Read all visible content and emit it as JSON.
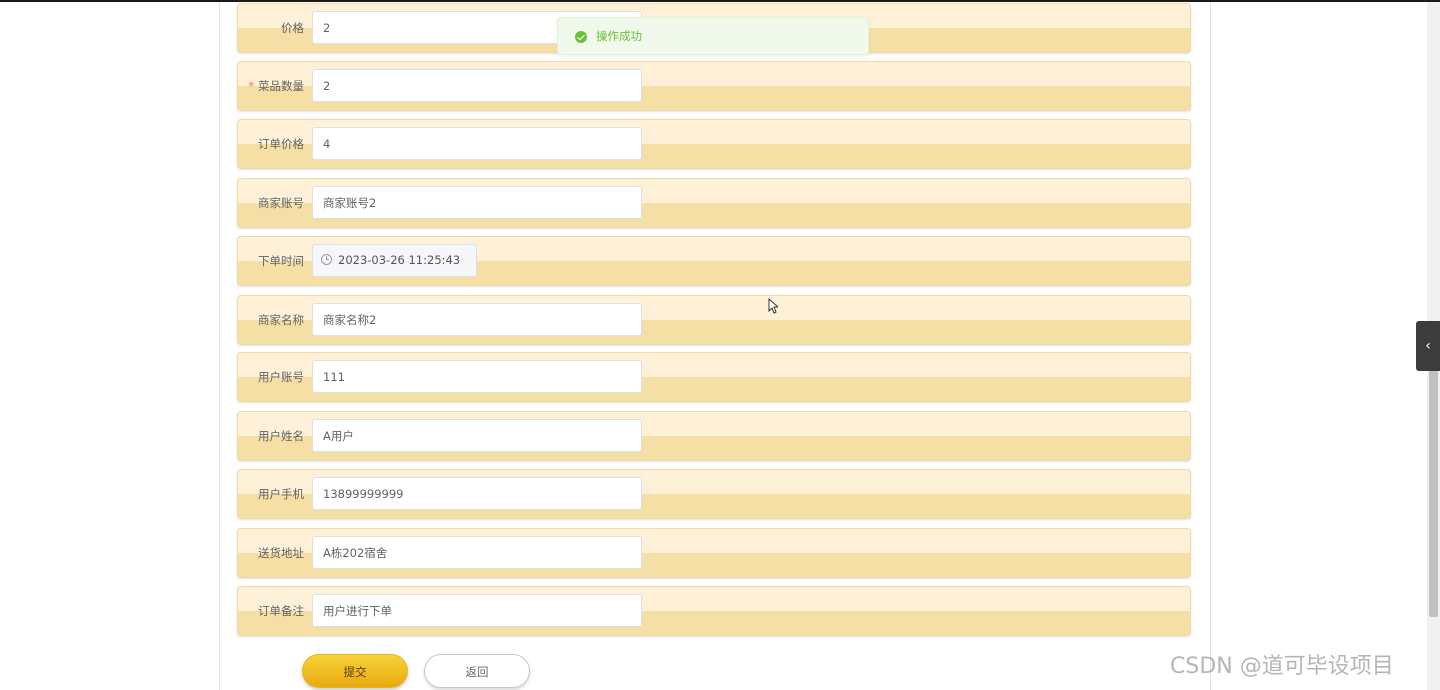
{
  "form": {
    "fields": [
      {
        "label": "价格",
        "required": false,
        "value": "2"
      },
      {
        "label": "菜品数量",
        "required": true,
        "value": "2"
      },
      {
        "label": "订单价格",
        "required": false,
        "value": "4"
      },
      {
        "label": "商家账号",
        "required": false,
        "value": "商家账号2"
      },
      {
        "label": "下单时间",
        "required": false,
        "value": "2023-03-26 11:25:43"
      },
      {
        "label": "商家名称",
        "required": false,
        "value": "商家名称2"
      },
      {
        "label": "用户账号",
        "required": false,
        "value": "111"
      },
      {
        "label": "用户姓名",
        "required": false,
        "value": "A用户"
      },
      {
        "label": "用户手机",
        "required": false,
        "value": "13899999999"
      },
      {
        "label": "送货地址",
        "required": false,
        "value": "A栋202宿舍"
      },
      {
        "label": "订单备注",
        "required": false,
        "value": "用户进行下单"
      }
    ],
    "required_mark": "*",
    "submit_label": "提交",
    "back_label": "返回"
  },
  "toast": {
    "message": "操作成功",
    "type": "success"
  },
  "side_toggle": {
    "icon": "chevron-left-icon",
    "glyph": "‹"
  },
  "watermark": "CSDN @道可毕设项目",
  "colors": {
    "row_top": "#fef1d7",
    "row_bottom": "#f6dfa4",
    "accent": "#f0c020",
    "success": "#67c23a",
    "required": "#f56c6c"
  }
}
